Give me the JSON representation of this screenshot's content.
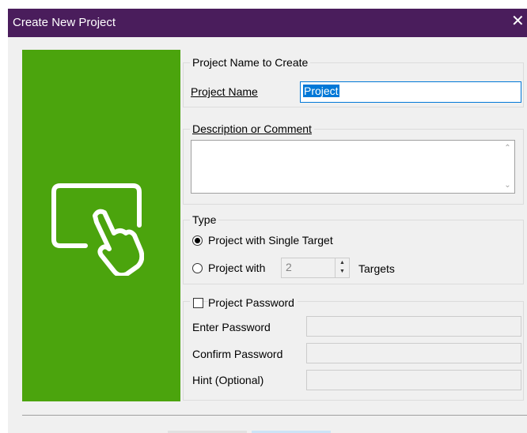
{
  "window": {
    "title": "Create New Project",
    "close_glyph": "✕"
  },
  "illustration": {
    "icon": "touch-screen-icon",
    "background_color": "#4ba40d"
  },
  "name_group": {
    "legend": "Project Name to Create",
    "label": "Project Name",
    "value": "Project"
  },
  "description_group": {
    "legend": "Description or Comment",
    "value": ""
  },
  "type_group": {
    "legend": "Type",
    "option_single": "Project with Single Target",
    "option_multi_prefix": "Project with",
    "targets_value": "2",
    "option_multi_suffix": "Targets",
    "selected": "single"
  },
  "password_group": {
    "legend": "Project Password",
    "checked": false,
    "enter_label": "Enter Password",
    "confirm_label": "Confirm Password",
    "hint_label": "Hint (Optional)"
  },
  "colors": {
    "titlebar": "#4a1d5c",
    "accent": "#0078d7"
  }
}
